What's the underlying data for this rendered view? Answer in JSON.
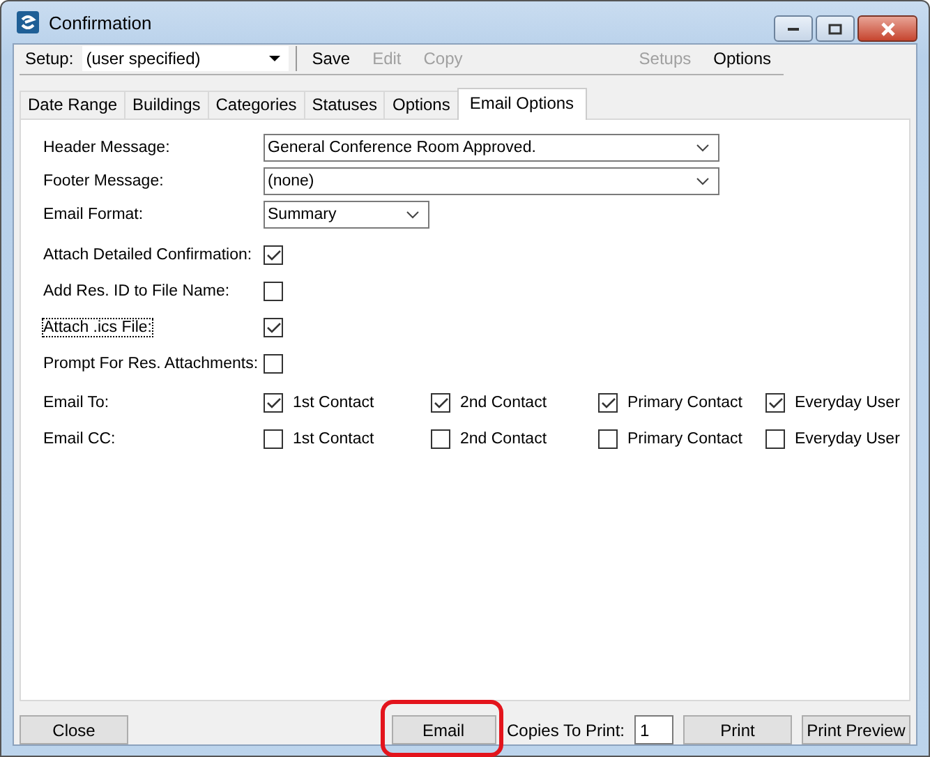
{
  "window": {
    "title": "Confirmation"
  },
  "toolbar": {
    "setup_label": "Setup:",
    "setup_value": "(user specified)",
    "actions": [
      {
        "label": "Save",
        "disabled": false
      },
      {
        "label": "Edit",
        "disabled": true
      },
      {
        "label": "Copy",
        "disabled": true
      }
    ],
    "right_actions": [
      {
        "label": "Setups",
        "disabled": true
      },
      {
        "label": "Options",
        "disabled": false
      }
    ]
  },
  "tabs": [
    {
      "label": "Date Range",
      "selected": false
    },
    {
      "label": "Buildings",
      "selected": false
    },
    {
      "label": "Categories",
      "selected": false
    },
    {
      "label": "Statuses",
      "selected": false
    },
    {
      "label": "Options",
      "selected": false
    },
    {
      "label": "Email Options",
      "selected": true
    }
  ],
  "dropdowns": [
    {
      "label": "Header Message:",
      "value": "General Conference Room Approved.",
      "kind": "wide"
    },
    {
      "label": "Footer Message:",
      "value": "(none)",
      "kind": "wide"
    },
    {
      "label": "Email Format:",
      "value": "Summary",
      "kind": "narrow"
    }
  ],
  "options": [
    {
      "label": "Attach Detailed Confirmation:",
      "checked": true,
      "focused": false
    },
    {
      "label": "Add Res. ID to File Name:",
      "checked": false,
      "focused": false
    },
    {
      "label": "Attach .ics File:",
      "checked": true,
      "focused": true
    },
    {
      "label": "Prompt For Res. Attachments:",
      "checked": false,
      "focused": false
    }
  ],
  "recipients": [
    {
      "label": "Email To:",
      "contacts": [
        {
          "label": "1st Contact",
          "checked": true
        },
        {
          "label": "2nd Contact",
          "checked": true
        },
        {
          "label": "Primary Contact",
          "checked": true
        },
        {
          "label": "Everyday User",
          "checked": true
        }
      ]
    },
    {
      "label": "Email CC:",
      "contacts": [
        {
          "label": "1st Contact",
          "checked": false
        },
        {
          "label": "2nd Contact",
          "checked": false
        },
        {
          "label": "Primary Contact",
          "checked": false
        },
        {
          "label": "Everyday User",
          "checked": false
        }
      ]
    }
  ],
  "footer": {
    "close": "Close",
    "email": {
      "label": "Email",
      "highlighted": true
    },
    "copies_label": "Copies To Print:",
    "copies_value": "1",
    "print": "Print",
    "print_preview": "Print Preview"
  }
}
